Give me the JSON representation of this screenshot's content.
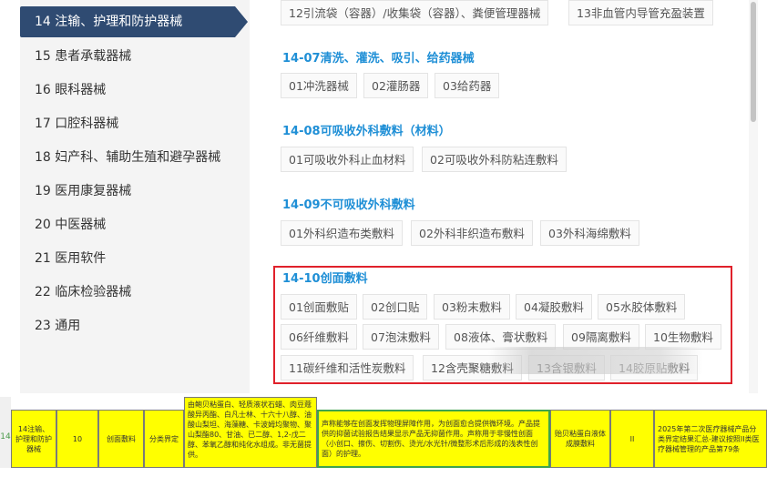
{
  "sidebar": {
    "active": "14 注输、护理和防护器械",
    "items": [
      "15 患者承载器械",
      "16 眼科器械",
      "17 口腔科器械",
      "18 妇产科、辅助生殖和避孕器械",
      "19 医用康复器械",
      "20 中医器械",
      "21 医用软件",
      "22 临床检验器械",
      "23 通用"
    ]
  },
  "content": {
    "top_chips": [
      "12引流袋（容器）/收集袋（容器）、粪便管理器械",
      "13非血管内导管充盈装置"
    ],
    "groups": [
      {
        "title": "14-07清洗、灌洗、吸引、给药器械",
        "chips": [
          "01冲洗器械",
          "02灌肠器",
          "03给药器"
        ]
      },
      {
        "title": "14-08可吸收外科敷料（材料）",
        "chips": [
          "01可吸收外科止血材料",
          "02可吸收外科防粘连敷料"
        ]
      },
      {
        "title": "14-09不可吸收外科敷料",
        "chips": [
          "01外科织造布类敷料",
          "02外科非织造布敷料",
          "03外科海绵敷料"
        ]
      },
      {
        "title": "14-10创面敷料",
        "chips": [
          "01创面敷贴",
          "02创口贴",
          "03粉末敷料",
          "04凝胶敷料",
          "05水胶体敷料",
          "06纤维敷料",
          "07泡沫敷料",
          "08液体、膏状敷料",
          "09隔离敷料",
          "10生物敷料",
          "11碳纤维和活性炭敷料",
          "12含壳聚糖敷料",
          "13含银敷料",
          "14胶原贴敷料"
        ]
      }
    ]
  },
  "sheet": {
    "row_number": "14",
    "cells": {
      "category": "14注输、护理和防护器械",
      "subcategory": "10",
      "product": "创面敷料",
      "type": "分类界定",
      "ingredients": "由鲍贝粘蛋白、轻质液状石蜡、肉豆蔻酸异丙酯、白凡士林、十六十八醇、油酸山梨坦、海藻糖、卡波姆均聚物、聚山梨酯80、甘油、已二醇、1,2-戊二醇、苯氧乙醇和纯化水组成。非无菌提供。",
      "claim": "声称能够在创面发挥物理屏障作用，为创面愈合提供微环境。产品提供的抑菌试验报告结果显示产品无抑菌作用。声称用于非慢性创面（小创口、擦伤、切割伤、烫光/水光针/微整形术后形成的浅表性创面）的护理。",
      "name": "贻贝粘蛋白液体成膜敷料",
      "class": "II",
      "note": "2025年第二次医疗器械产品分类界定结果汇总-建议按照II类医疗器械管理的产品第79条"
    }
  },
  "colors": {
    "accent": "#2f4b72",
    "link": "#1f8fd6",
    "highlight": "#e0212b",
    "cell_fill": "#ffff00"
  }
}
